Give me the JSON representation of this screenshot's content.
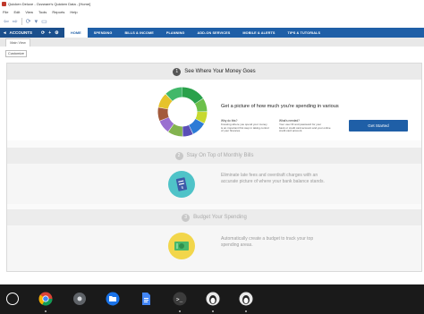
{
  "window": {
    "title": "Quicken Deluxe - Ozzware's Quicken Data - [Home]",
    "menu": [
      "File",
      "Edit",
      "View",
      "Tools",
      "Reports",
      "Help"
    ]
  },
  "nav": {
    "accounts_label": "ACCOUNTS",
    "tabs": [
      "HOME",
      "SPENDING",
      "BILLS & INCOME",
      "PLANNING",
      "ADD-ON SERVICES",
      "MOBILE & ALERTS",
      "TIPS & TUTORIALS"
    ],
    "active_tab": "HOME",
    "colors": {
      "nav_bg": "#1f5fa7",
      "accounts_bg": "#1b4f8c"
    }
  },
  "subnav": {
    "tab": "Main View"
  },
  "customize_label": "Customize",
  "steps": [
    {
      "number": "1",
      "title": "See Where Your Money Goes",
      "heading": "Get a picture of how much you're spending in various",
      "col1": {
        "head": "Why do this?",
        "lines": [
          "Knowing where you spend your money",
          "is an important first step in taking control",
          "of your finances."
        ]
      },
      "col2": {
        "head": "What's needed?",
        "lines": [
          "Your user ID and password for your",
          "bank or credit card account and your online",
          "credit card account."
        ]
      },
      "button": "Get Started"
    },
    {
      "number": "2",
      "title": "Stay On Top of Monthly Bills",
      "text_lines": [
        "Eliminate late fees and overdraft charges with an",
        "accurate picture of where your bank balance stands."
      ]
    },
    {
      "number": "3",
      "title": "Budget Your Spending",
      "text_lines": [
        "Automatically create a budget to track your top",
        "spending areas."
      ]
    }
  ],
  "donut": {
    "segments": [
      {
        "value": 16,
        "color": "#2aa14b"
      },
      {
        "value": 9,
        "color": "#6cc04a"
      },
      {
        "value": 8,
        "color": "#c7d92f"
      },
      {
        "value": 10,
        "color": "#2c7bd6"
      },
      {
        "value": 7,
        "color": "#5a4fb7"
      },
      {
        "value": 10,
        "color": "#83b34f"
      },
      {
        "value": 9,
        "color": "#9a6fd0"
      },
      {
        "value": 9,
        "color": "#a35a3c"
      },
      {
        "value": 10,
        "color": "#e6c32b"
      },
      {
        "value": 12,
        "color": "#42b86a"
      }
    ]
  },
  "shelf": {
    "apps": [
      "launcher-icon",
      "chrome-icon",
      "settings-icon",
      "files-icon",
      "docs-icon",
      "terminal-icon",
      "penguin-icon",
      "linux-app-icon"
    ]
  }
}
